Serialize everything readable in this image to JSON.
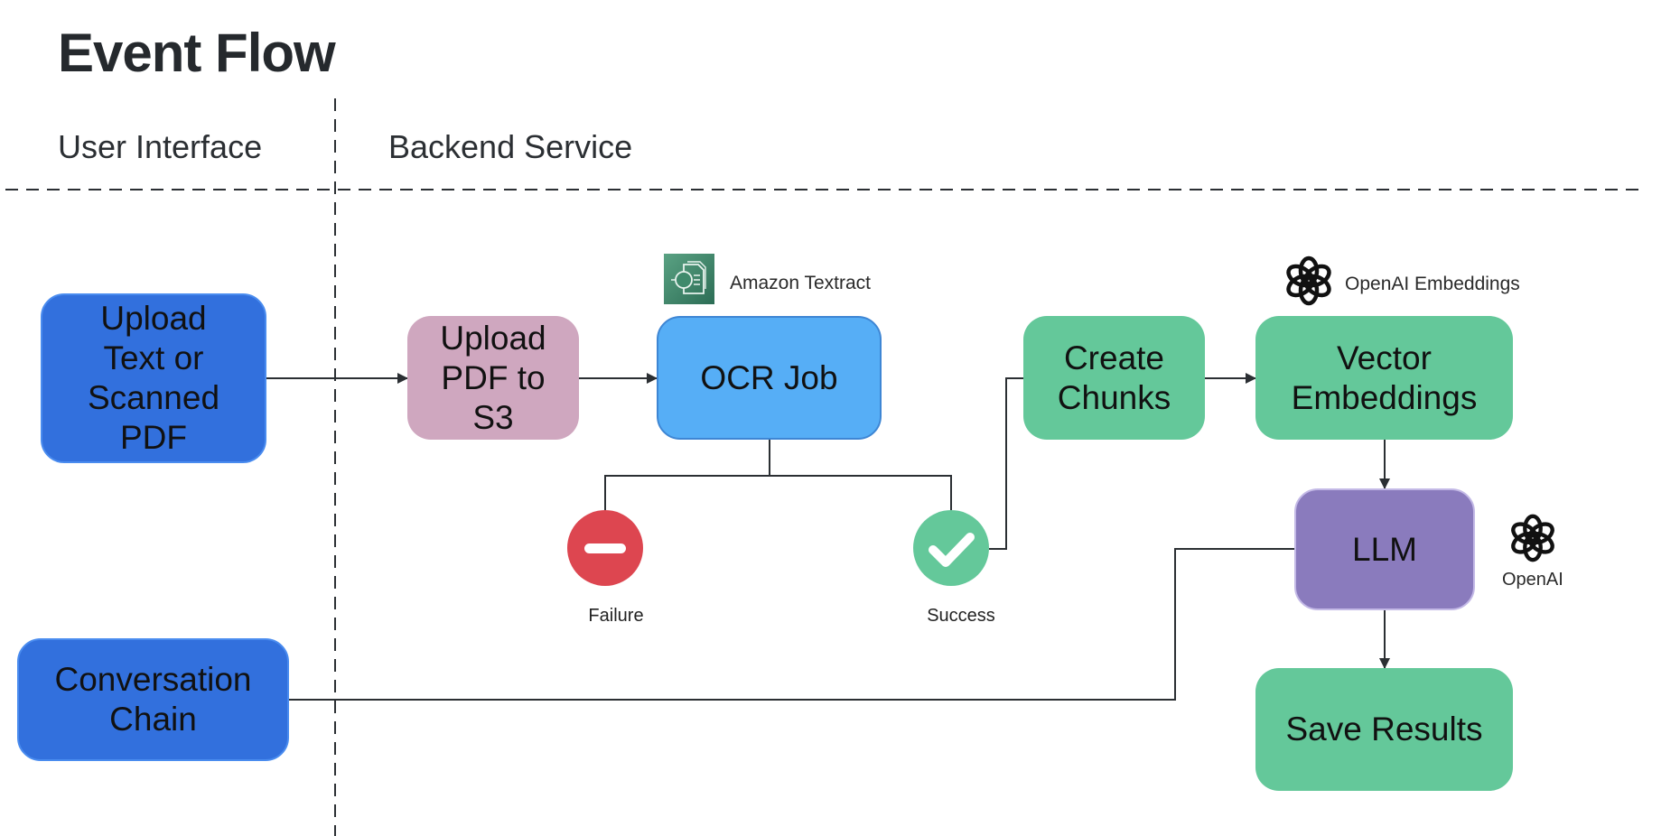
{
  "title": "Event Flow",
  "lanes": {
    "left": "User Interface",
    "right": "Backend Service"
  },
  "nodes": {
    "upload_text": "Upload\nText or\nScanned\nPDF",
    "upload_s3": "Upload\nPDF to\nS3",
    "ocr_job": "OCR Job",
    "create_chunks": "Create\nChunks",
    "vector_embeddings": "Vector\nEmbeddings",
    "llm": "LLM",
    "save_results": "Save Results",
    "conversation_chain": "Conversation\nChain"
  },
  "statuses": {
    "failure": "Failure",
    "success": "Success"
  },
  "services": {
    "textract": {
      "label": "Amazon Textract",
      "icon": "amazon-textract-icon"
    },
    "openai_embeddings": {
      "label": "OpenAI Embeddings",
      "icon": "openai-logo-icon"
    },
    "openai_llm": {
      "label": "OpenAI",
      "icon": "openai-logo-icon"
    }
  },
  "colors": {
    "ui_node": "#3270dd",
    "s3_node": "#cfa7bf",
    "ocr_node": "#56aef6",
    "green_node": "#64c89a",
    "llm_node": "#8a7bbd",
    "failure": "#dd4650",
    "success": "#64c89a"
  }
}
